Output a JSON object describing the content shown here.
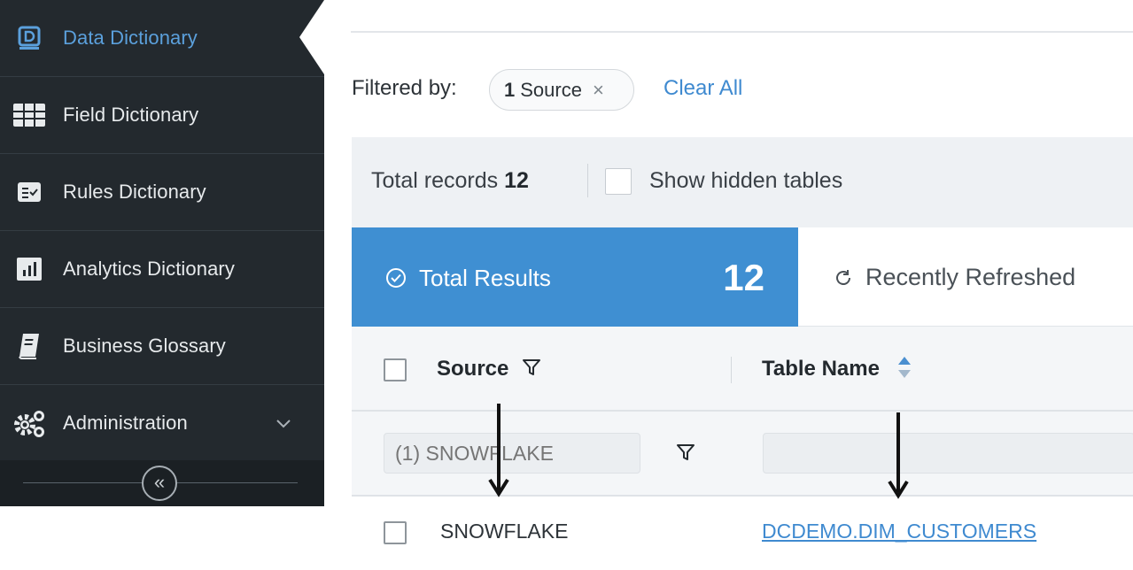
{
  "sidebar": {
    "items": [
      {
        "label": "Data Dictionary",
        "icon": "data-dictionary-icon",
        "active": true
      },
      {
        "label": "Field Dictionary",
        "icon": "field-dictionary-icon"
      },
      {
        "label": "Rules Dictionary",
        "icon": "rules-dictionary-icon"
      },
      {
        "label": "Analytics Dictionary",
        "icon": "analytics-dictionary-icon"
      },
      {
        "label": "Business Glossary",
        "icon": "business-glossary-icon"
      },
      {
        "label": "Administration",
        "icon": "gears-icon"
      }
    ],
    "collapse_glyph": "«"
  },
  "filters": {
    "label": "Filtered by:",
    "chip_count": "1",
    "chip_text": "Source",
    "chip_remove": "×",
    "clear_all": "Clear All"
  },
  "records": {
    "label": "Total records",
    "count": "12",
    "show_hidden_label": "Show hidden tables"
  },
  "tabs": {
    "total_label": "Total Results",
    "total_count": "12",
    "recent_label": "Recently Refreshed"
  },
  "table": {
    "columns": {
      "source": "Source",
      "table_name": "Table Name"
    },
    "filters": {
      "source_placeholder": "(1) SNOWFLAKE",
      "table_placeholder": ""
    },
    "rows": [
      {
        "source": "SNOWFLAKE",
        "table_name": "DCDEMO.DIM_CUSTOMERS"
      }
    ]
  },
  "colors": {
    "sidebar_bg": "#23292e",
    "accent_blue": "#3f8fd2",
    "link_blue": "#3f8ad0"
  }
}
